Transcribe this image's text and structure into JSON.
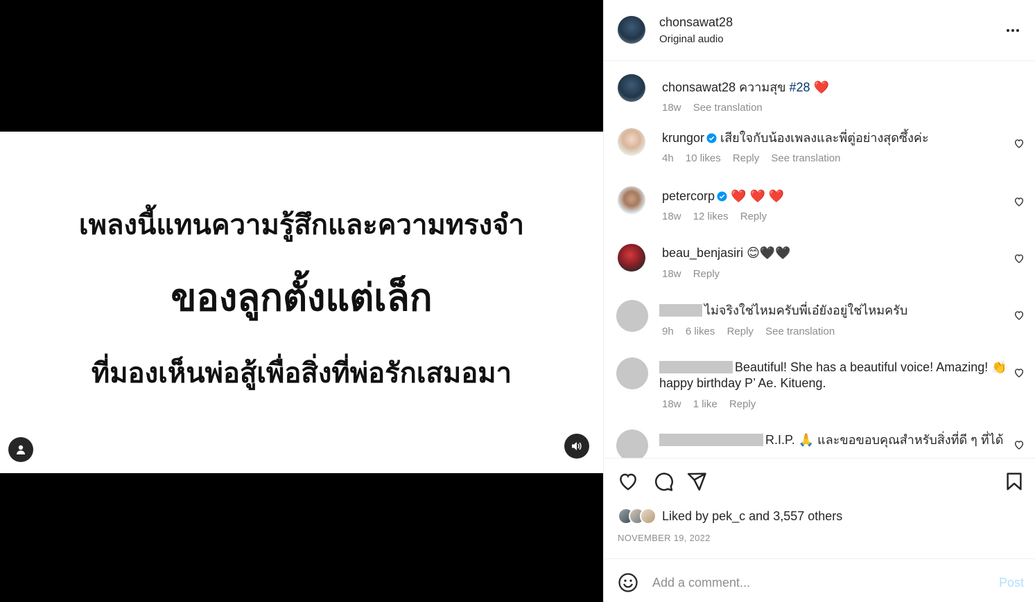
{
  "media": {
    "lines": [
      "เพลงนี้แทนความรู้สึกและความทรงจำ",
      "ของลูกตั้งแต่เล็ก",
      "ที่มองเห็นพ่อสู้เพื่อสิ่งที่พ่อรักเสมอมา"
    ],
    "tag_icon": "user-icon",
    "audio_icon": "speaker-icon"
  },
  "header": {
    "username": "chonsawat28",
    "audio": "Original audio"
  },
  "caption": {
    "username": "chonsawat28",
    "text": "ความสุข",
    "hashtag": "#28",
    "emoji": "❤️",
    "time": "18w",
    "see_translation": "See translation"
  },
  "comments": [
    {
      "username": "krungor",
      "verified": true,
      "text": "เสียใจกับน้องเพลงและพี่ตู่อย่างสุดซึ้งค่ะ",
      "time": "4h",
      "likes": "10 likes",
      "reply": "Reply",
      "see_translation": "See translation"
    },
    {
      "username": "petercorp",
      "verified": true,
      "text": "❤️ ❤️ ❤️",
      "time": "18w",
      "likes": "12 likes",
      "reply": "Reply"
    },
    {
      "username": "beau_benjasiri",
      "verified": false,
      "text": "😊🖤🖤",
      "time": "18w",
      "reply": "Reply"
    },
    {
      "username": "",
      "text": "ไม่จริงใช่ไหมครับพี่เอ๋ยังอยู่ใช่ไหมครับ",
      "time": "9h",
      "likes": "6 likes",
      "reply": "Reply",
      "see_translation": "See translation"
    },
    {
      "username": "",
      "text": "Beautiful! She has a beautiful voice! Amazing! 👏 happy birthday P’ Ae. Kitueng.",
      "time": "18w",
      "likes": "1 like",
      "reply": "Reply"
    },
    {
      "username": "",
      "text": "R.I.P. 🙏 และขอขอบคุณสำหรับสิ่งที่ดี ๆ ที่ได้"
    }
  ],
  "liked_by": {
    "prefix": "Liked by",
    "user": "pek_c",
    "and": "and",
    "others": "3,557 others"
  },
  "date": "NOVEMBER 19, 2022",
  "comment_box": {
    "placeholder": "Add a comment...",
    "post": "Post"
  },
  "colors": {
    "text": "#262626",
    "secondary": "#8e8e8e",
    "verified": "#0095f6",
    "heart": "#ed4956",
    "post_disabled": "#b2dffc",
    "hashtag": "#00376b"
  }
}
